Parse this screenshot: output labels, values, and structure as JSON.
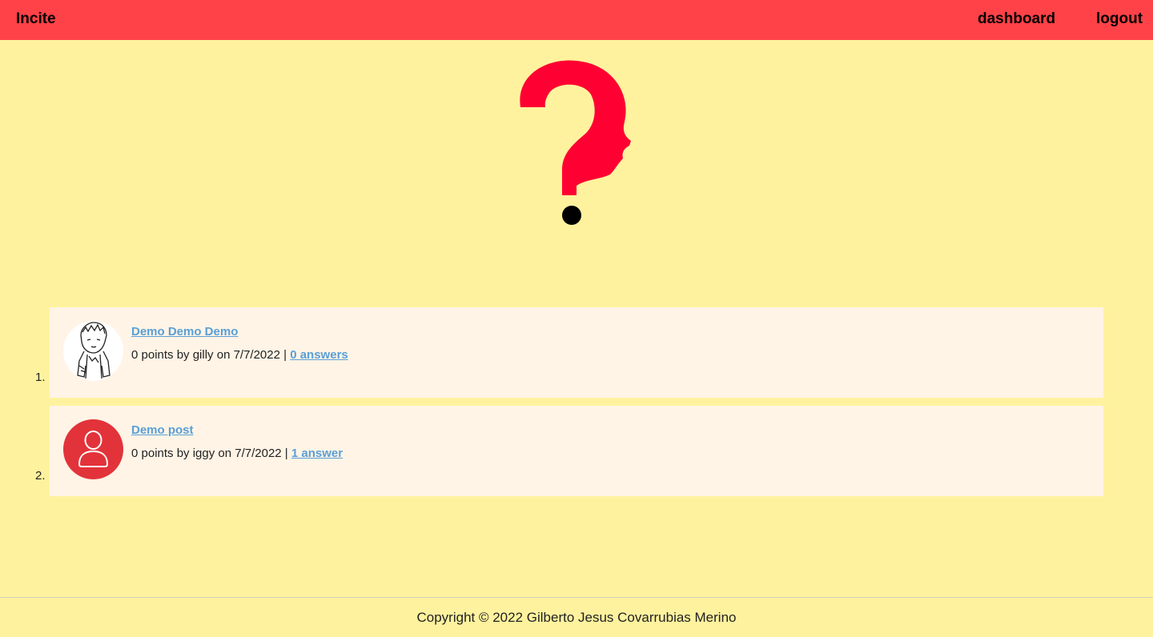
{
  "navbar": {
    "brand": "Incite",
    "links": [
      {
        "label": "dashboard"
      },
      {
        "label": "logout"
      }
    ],
    "color": "#ff4247"
  },
  "hero": {
    "icon": "question-mark-head-icon",
    "color": "#ff0033"
  },
  "posts": [
    {
      "number": "1.",
      "title": "Demo Demo Demo",
      "meta_prefix": "0 points by gilly on 7/7/2022 | ",
      "answers": "0 answers",
      "avatar": "sketch-avatar"
    },
    {
      "number": "2.",
      "title": "Demo post",
      "meta_prefix": "0 points by iggy on 7/7/2022 | ",
      "answers": "1 answer",
      "avatar": "default-user-icon"
    }
  ],
  "footer": {
    "copyright": "Copyright © 2022 Gilberto Jesus Covarrubias Merino"
  },
  "colors": {
    "background": "#fff29e",
    "card": "#fff4e6",
    "link": "#5a9fd6",
    "avatar_red": "#e2333a"
  }
}
